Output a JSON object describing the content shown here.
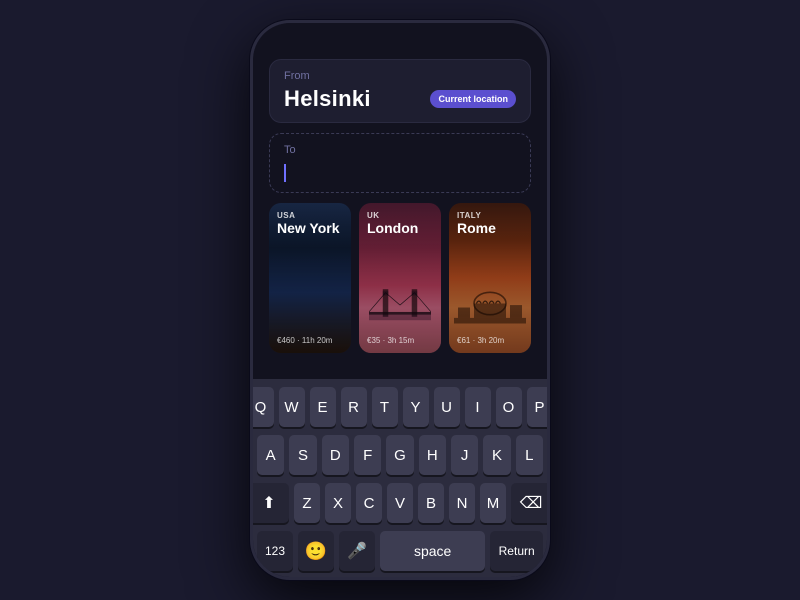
{
  "phone": {
    "statusBar": ""
  },
  "fromField": {
    "label": "From",
    "value": "Helsinki",
    "currentLocationLabel": "Current location"
  },
  "toField": {
    "label": "To"
  },
  "destinations": [
    {
      "id": "new-york",
      "country": "USA",
      "city": "New York",
      "price": "€460 · 11h 20m",
      "cardClass": "card-ny"
    },
    {
      "id": "london",
      "country": "UK",
      "city": "London",
      "price": "€35 · 3h 15m",
      "cardClass": "card-london"
    },
    {
      "id": "rome",
      "country": "ITALY",
      "city": "Rome",
      "price": "€61 · 3h 20m",
      "cardClass": "card-rome"
    }
  ],
  "keyboard": {
    "row1": [
      "Q",
      "W",
      "E",
      "R",
      "T",
      "Y",
      "U",
      "I",
      "O",
      "P"
    ],
    "row2": [
      "A",
      "S",
      "D",
      "F",
      "G",
      "H",
      "J",
      "K",
      "L"
    ],
    "row3": [
      "Z",
      "X",
      "C",
      "V",
      "B",
      "N",
      "M"
    ],
    "spaceLabel": "space",
    "returnLabel": "Return",
    "numberLabel": "123"
  }
}
